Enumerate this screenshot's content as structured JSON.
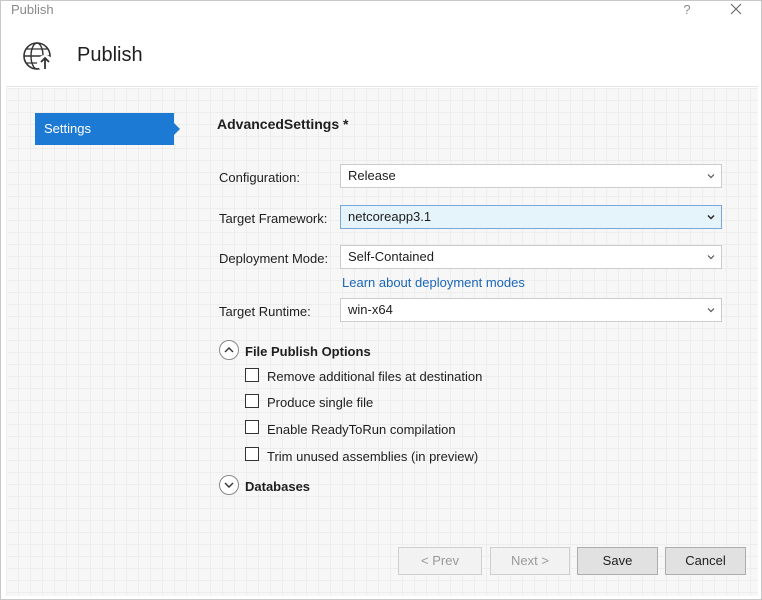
{
  "window": {
    "title": "Publish",
    "help": "?"
  },
  "header": {
    "title": "Publish"
  },
  "nav": {
    "settings_label": "Settings"
  },
  "section": {
    "title": "AdvancedSettings *"
  },
  "form": {
    "configuration": {
      "label": "Configuration:",
      "value": "Release"
    },
    "target_framework": {
      "label": "Target Framework:",
      "value": "netcoreapp3.1"
    },
    "deployment_mode": {
      "label": "Deployment Mode:",
      "value": "Self-Contained",
      "link": "Learn about deployment modes"
    },
    "target_runtime": {
      "label": "Target Runtime:",
      "value": "win-x64"
    }
  },
  "file_publish_options": {
    "label": "File Publish Options",
    "expanded": true,
    "options": [
      {
        "label": "Remove additional files at destination",
        "checked": false
      },
      {
        "label": "Produce single file",
        "checked": false
      },
      {
        "label": "Enable ReadyToRun compilation",
        "checked": false
      },
      {
        "label": "Trim unused assemblies (in preview)",
        "checked": false
      }
    ]
  },
  "databases": {
    "label": "Databases",
    "expanded": false
  },
  "buttons": {
    "prev": "< Prev",
    "next": "Next >",
    "save": "Save",
    "cancel": "Cancel"
  },
  "icons": {
    "header": "globe-upload-icon",
    "close": "close-icon",
    "chevron": "chevron-down-icon"
  },
  "colors": {
    "accent": "#1c7ad4",
    "link": "#1a66b8",
    "focused_field": "#e5f3fb"
  }
}
